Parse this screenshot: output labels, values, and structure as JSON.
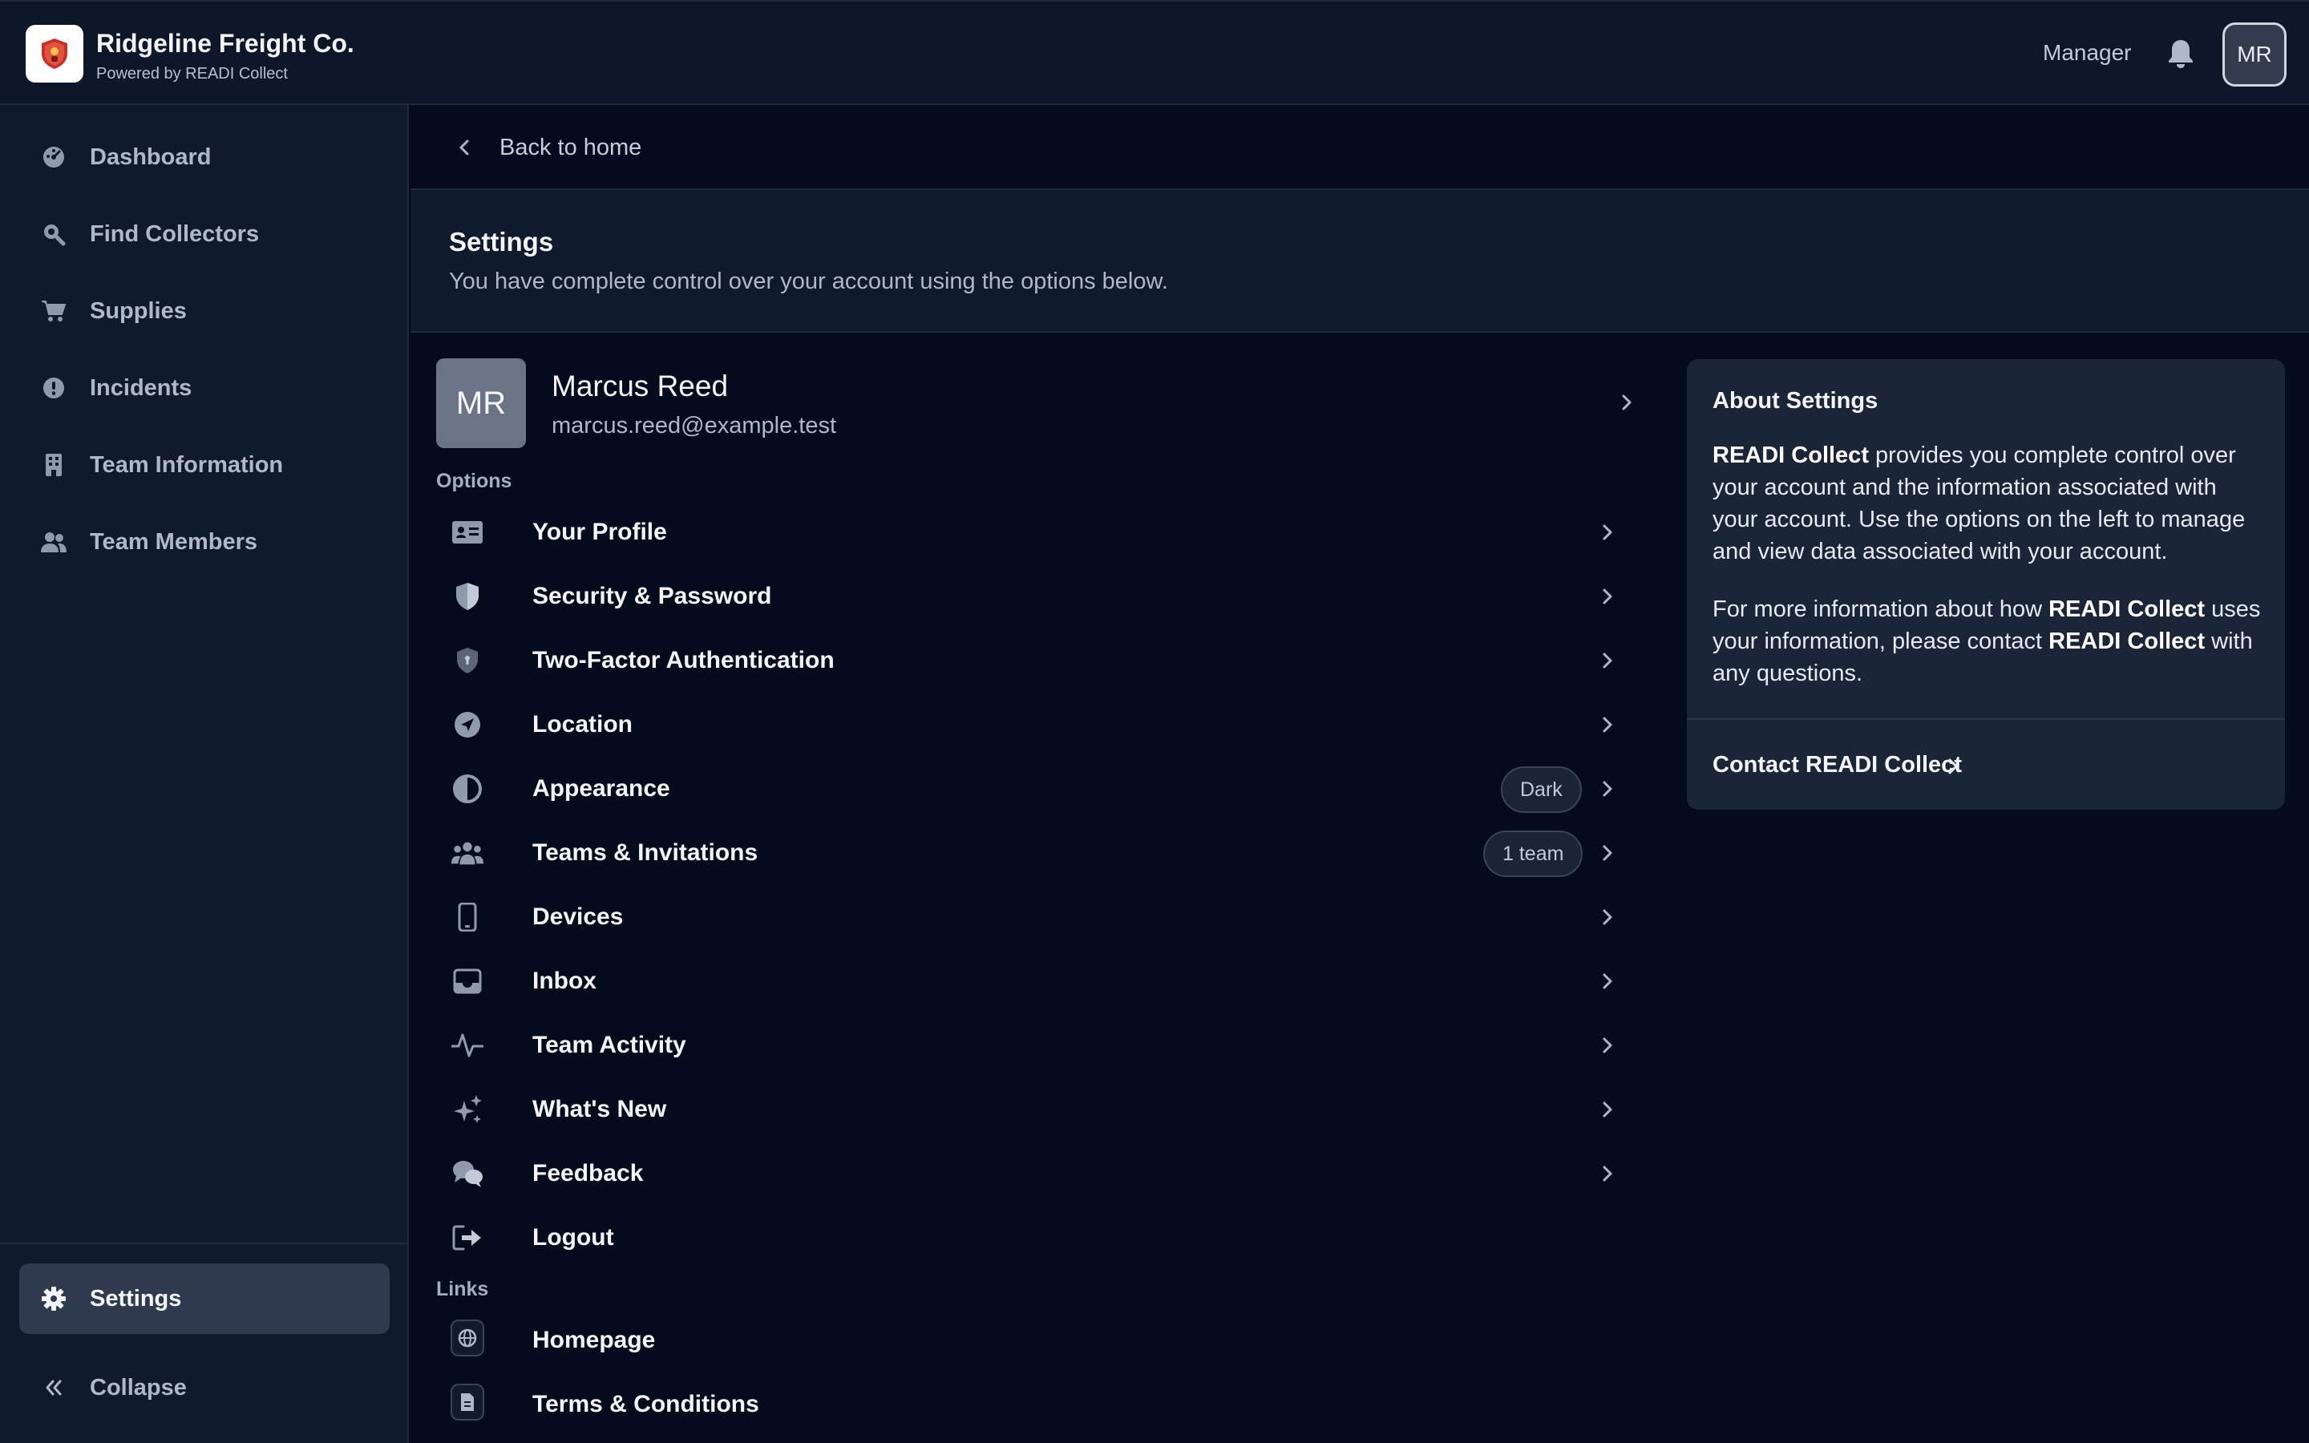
{
  "topbar": {
    "org_name": "Ridgeline Freight Co.",
    "org_sub": "Powered by READI Collect",
    "role": "Manager",
    "avatar_initials": "MR"
  },
  "sidebar": {
    "items": [
      {
        "label": "Dashboard",
        "icon": "dashboard-icon"
      },
      {
        "label": "Find Collectors",
        "icon": "search-icon"
      },
      {
        "label": "Supplies",
        "icon": "cart-icon"
      },
      {
        "label": "Incidents",
        "icon": "alert-icon"
      },
      {
        "label": "Team Information",
        "icon": "building-icon"
      },
      {
        "label": "Team Members",
        "icon": "users-icon"
      }
    ],
    "settings_label": "Settings",
    "collapse_label": "Collapse"
  },
  "main": {
    "back_label": "Back to home",
    "title": "Settings",
    "subtitle": "You have complete control over your account using the options below.",
    "profile": {
      "initials": "MR",
      "name": "Marcus Reed",
      "email": "marcus.reed@example.test"
    },
    "options_label": "Options",
    "options": [
      {
        "label": "Your Profile",
        "icon": "id-card-icon"
      },
      {
        "label": "Security & Password",
        "icon": "shield-icon"
      },
      {
        "label": "Two-Factor Authentication",
        "icon": "shield-lock-icon"
      },
      {
        "label": "Location",
        "icon": "location-arrow-icon"
      },
      {
        "label": "Appearance",
        "icon": "contrast-icon",
        "badge": "Dark"
      },
      {
        "label": "Teams & Invitations",
        "icon": "team-icon",
        "badge": "1 team"
      },
      {
        "label": "Devices",
        "icon": "phone-icon"
      },
      {
        "label": "Inbox",
        "icon": "inbox-icon"
      },
      {
        "label": "Team Activity",
        "icon": "activity-icon"
      },
      {
        "label": "What's New",
        "icon": "sparkles-icon"
      },
      {
        "label": "Feedback",
        "icon": "chat-icon"
      },
      {
        "label": "Logout",
        "icon": "logout-icon"
      }
    ],
    "links_label": "Links",
    "links": [
      {
        "label": "Homepage",
        "icon": "globe-icon"
      },
      {
        "label": "Terms & Conditions",
        "icon": "document-icon"
      }
    ]
  },
  "about": {
    "title": "About Settings",
    "p1_brand": "READI Collect",
    "p1_text": " provides you complete control over your account and the information associated with your account. Use the options on the left to manage and view data associated with your account.",
    "p2_a": "For more information about how ",
    "p2_brand1": "READI Collect",
    "p2_b": " uses your information, please contact ",
    "p2_brand2": "READI Collect",
    "p2_c": " with any questions.",
    "contact_label": "Contact READI Collect"
  },
  "colors": {
    "background": "#040b1c",
    "panel": "#101a2d",
    "card": "#1b2538",
    "active_nav": "#2f3a4f",
    "text": "#f3f5f9",
    "muted": "#aeb8c8"
  }
}
